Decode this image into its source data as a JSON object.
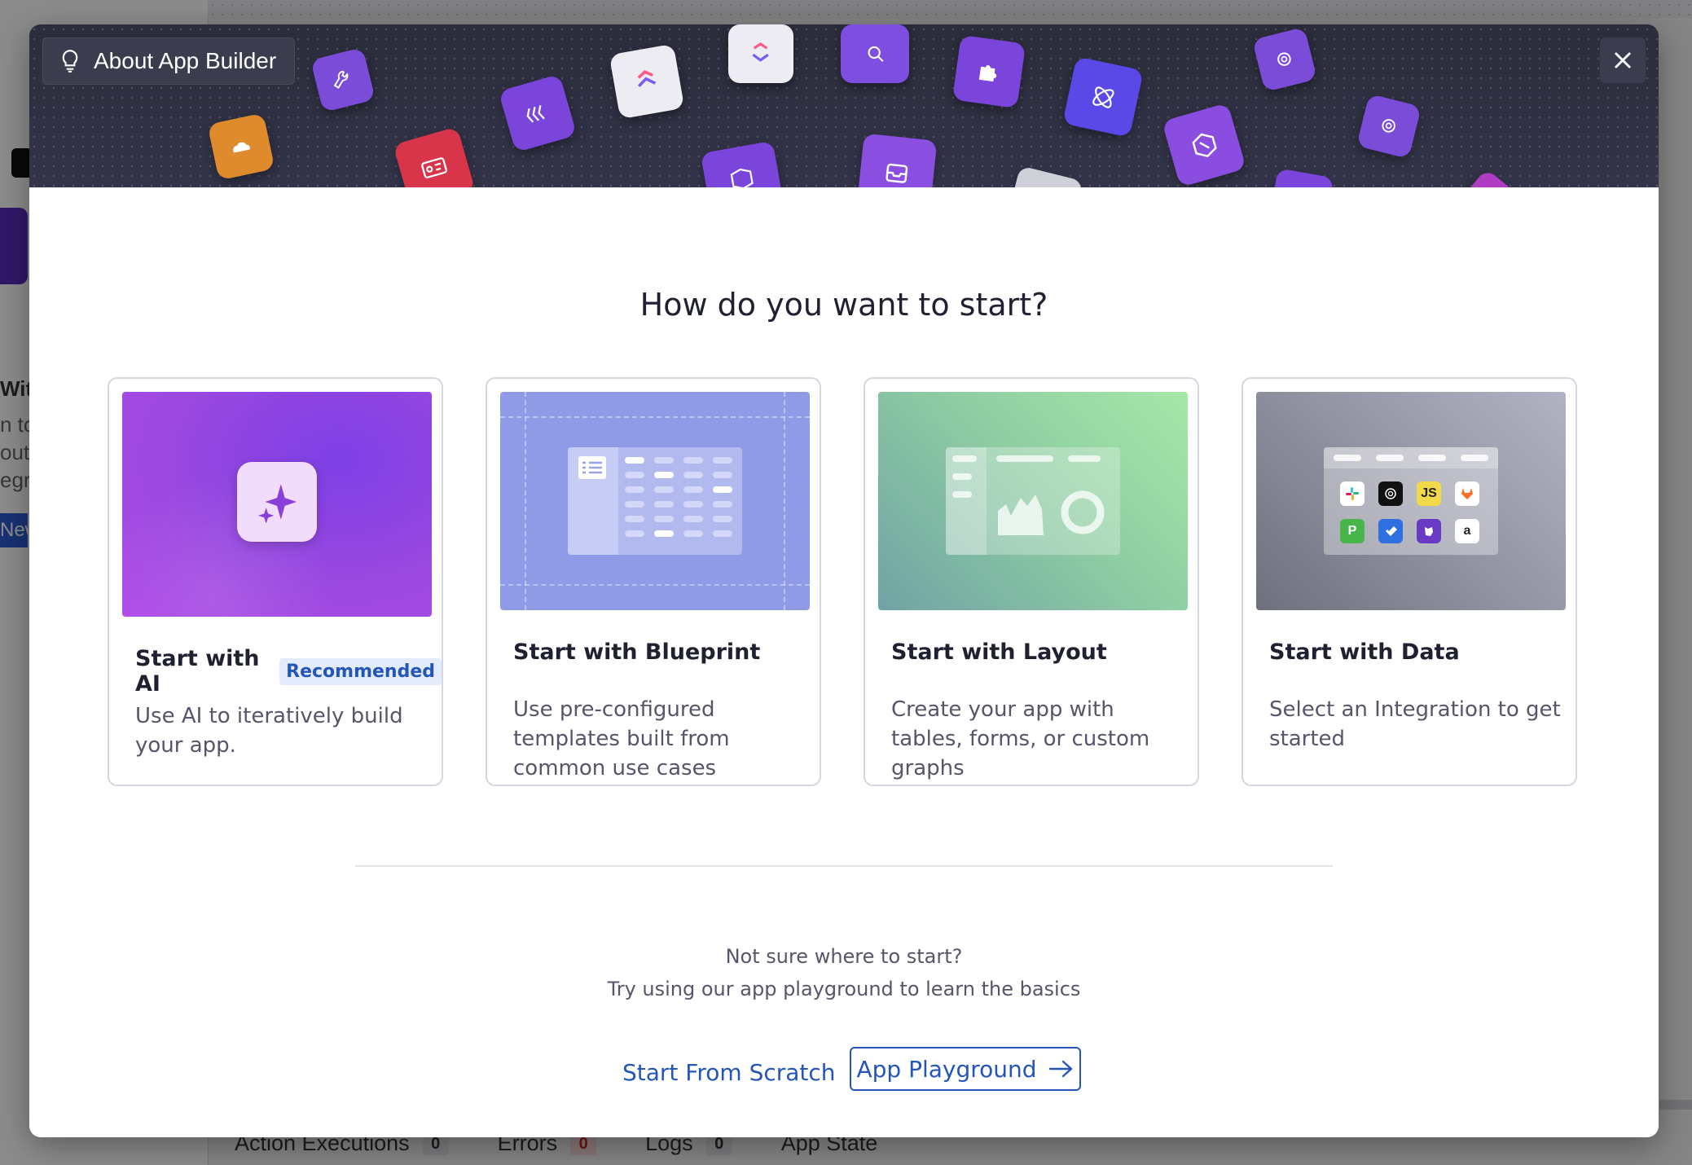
{
  "background": {
    "left_fragments": [
      "With",
      "n to",
      "out",
      "egra"
    ],
    "new_button_fragment": "New",
    "bottom_tabs": [
      {
        "label": "Action Executions",
        "count": "0"
      },
      {
        "label": "Errors",
        "count": "0"
      },
      {
        "label": "Logs",
        "count": "0"
      },
      {
        "label": "App State",
        "count": ""
      }
    ]
  },
  "modal": {
    "about_label": "About App Builder",
    "heading": "How do you want to start?",
    "cards": [
      {
        "title": "Start with AI",
        "badge": "Recommended",
        "description": "Use AI to iteratively build your app."
      },
      {
        "title": "Start with Blueprint",
        "description": "Use pre-configured templates built from common use cases"
      },
      {
        "title": "Start with Layout",
        "description": "Create your app with tables, forms, or custom graphs"
      },
      {
        "title": "Start with Data",
        "description": "Select an Integration to get started"
      }
    ],
    "footer": {
      "question": "Not sure where to start?",
      "suggestion": "Try using our app playground to learn the basics",
      "scratch_link": "Start From Scratch",
      "playground_button": "App Playground"
    },
    "data_card_icons": [
      "slack-icon",
      "openai-icon",
      "javascript-icon",
      "gitlab-icon",
      "pagerduty-icon",
      "jira-icon",
      "datadog-icon",
      "amazon-icon"
    ],
    "data_card_icon_text": {
      "js": "JS",
      "pagerduty": "P",
      "amazon": "a"
    }
  },
  "colors": {
    "accent": "#2456b8",
    "ai_card_gradient_start": "#9a48e0",
    "ai_card_gradient_end": "#7b3fe0",
    "blueprint_bg": "#8f9be6",
    "layout_bg_start": "#6fa3a4",
    "layout_bg_end": "#a5e8a8",
    "data_bg_start": "#6e707e",
    "data_bg_end": "#b1b3c4",
    "banner_bg": "#2e2f3f"
  }
}
